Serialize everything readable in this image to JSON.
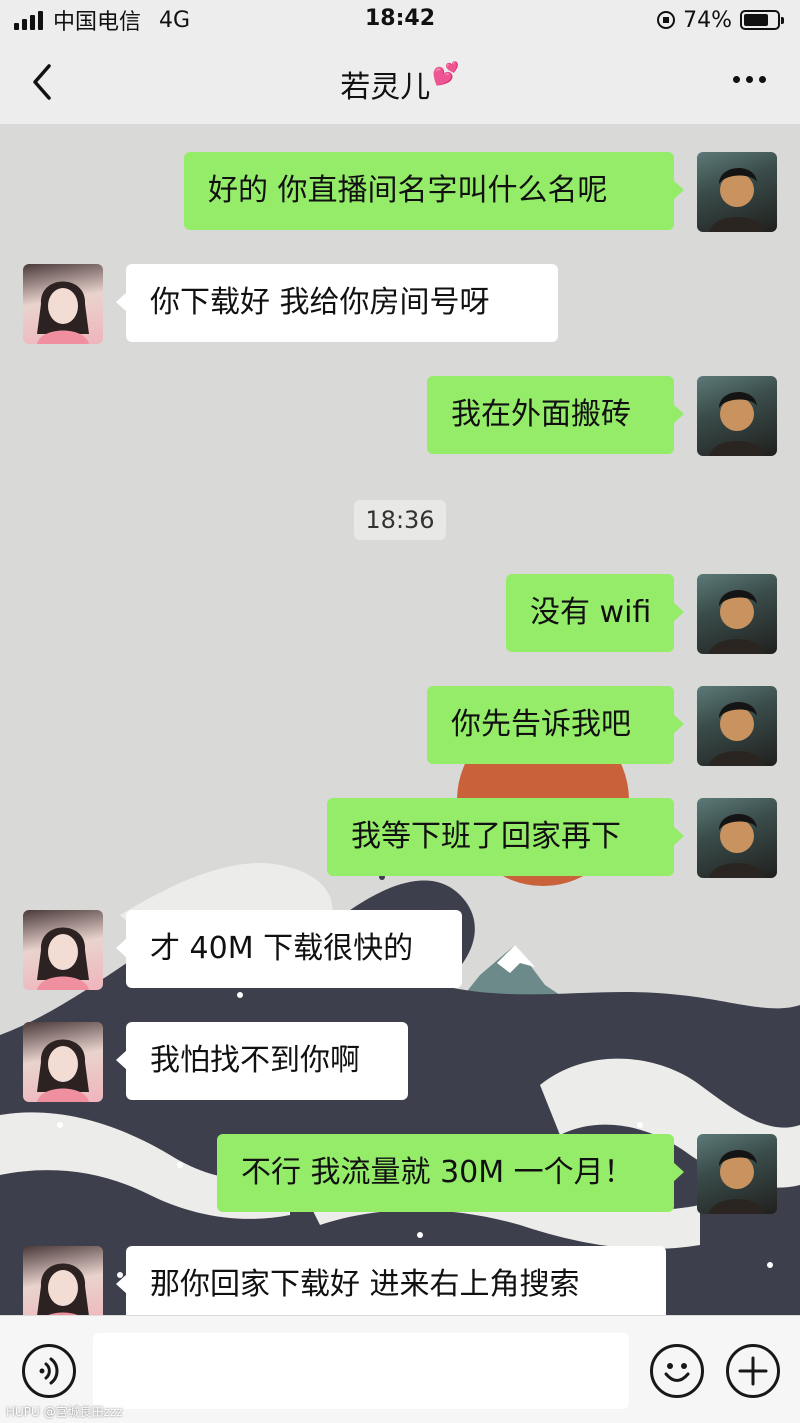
{
  "status_bar": {
    "carrier": "中国电信",
    "network": "4G",
    "time": "18:42",
    "battery": "74%",
    "battery_level": 0.74
  },
  "header": {
    "title": "若灵儿",
    "title_emoji": "💕"
  },
  "chat": {
    "timestamp": "18:36",
    "messages": [
      {
        "sender": "me",
        "text": "好的 你直播间名字叫什么名呢"
      },
      {
        "sender": "her",
        "text": "你下载好  我给你房间号呀"
      },
      {
        "sender": "me",
        "text": "我在外面搬砖"
      },
      {
        "sender": "me",
        "text": "没有 wifi"
      },
      {
        "sender": "me",
        "text": "你先告诉我吧"
      },
      {
        "sender": "me",
        "text": "我等下班了回家再下"
      },
      {
        "sender": "her",
        "text": "才 40M  下载很快的"
      },
      {
        "sender": "her",
        "text": "我怕找不到你啊"
      },
      {
        "sender": "me",
        "text": "不行 我流量就 30M 一个月！"
      },
      {
        "sender": "her",
        "text": "那你回家下载好  进来右上角搜索"
      }
    ]
  },
  "input_bar": {
    "voice_icon": "voice-icon",
    "emoji_icon": "emoji-icon",
    "add_icon": "plus-icon"
  },
  "watermark": "HUPU @宫城良田zzz",
  "colors": {
    "sent_bubble": "#95ec69",
    "received_bubble": "#ffffff",
    "wallpaper_sun": "#c9623a",
    "wallpaper_wave": "#3d3f4c"
  }
}
